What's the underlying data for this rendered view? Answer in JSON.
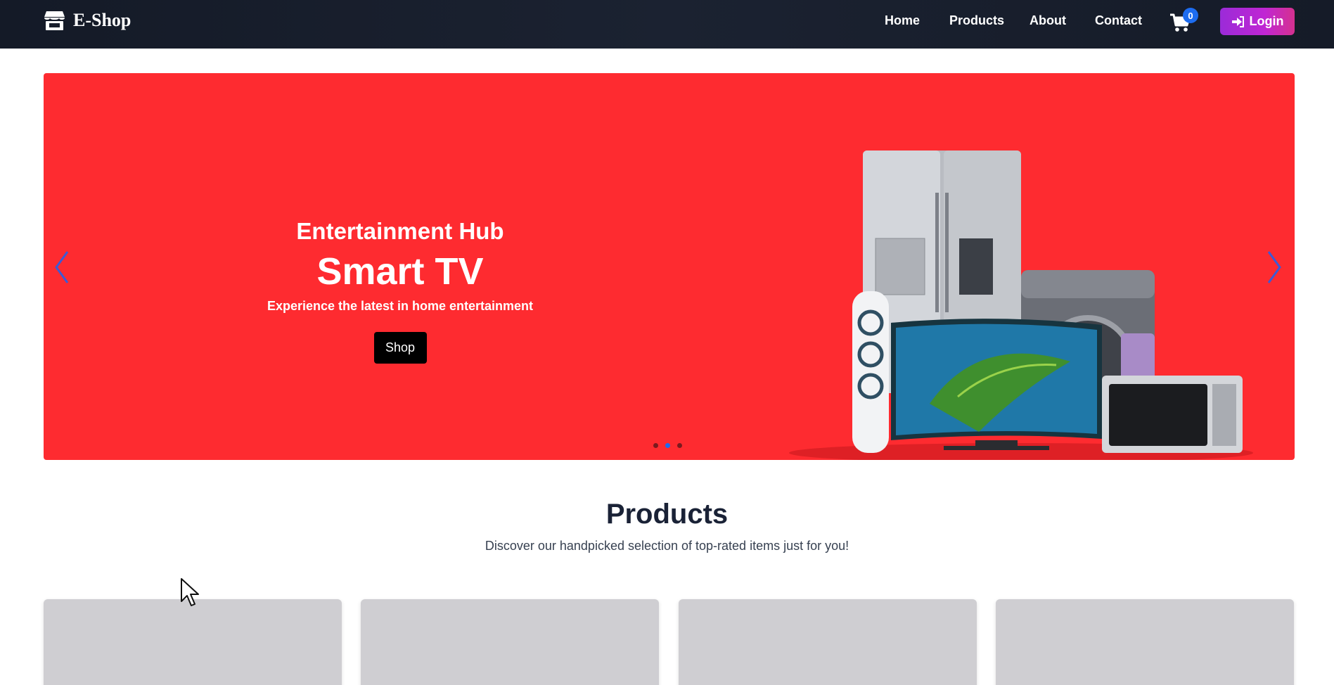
{
  "brand": {
    "name": "E-Shop",
    "icon": "store-icon"
  },
  "nav": {
    "links": [
      "Home",
      "Products",
      "About",
      "Contact"
    ],
    "cart_icon": "shopping-cart-icon",
    "cart_count": "0",
    "login_label": "Login",
    "login_icon": "sign-in-icon"
  },
  "hero": {
    "kicker": "Entertainment Hub",
    "title": "Smart TV",
    "subtitle": "Experience the latest in home entertainment",
    "button_label": "Shop",
    "background": "#fe2b30",
    "slides_total": 3,
    "active_slide": 2,
    "prev_icon": "chevron-left-icon",
    "next_icon": "chevron-right-icon"
  },
  "products": {
    "title": "Products",
    "subtitle": "Discover our handpicked selection of top-rated items just for you!",
    "cards": [
      {},
      {},
      {},
      {}
    ]
  },
  "colors": {
    "navbar": "#171d2b",
    "accent_blue": "#1d6cf0",
    "login_gradient": [
      "#9b2bd8",
      "#d5318f"
    ]
  }
}
